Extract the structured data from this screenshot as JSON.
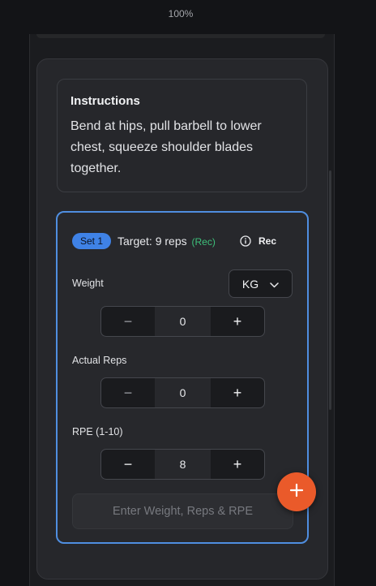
{
  "zoom": "100%",
  "instructions": {
    "title": "Instructions",
    "text": "Bend at hips, pull barbell to lower chest, squeeze shoulder blades together."
  },
  "set": {
    "badge": "Set 1",
    "target": "Target: 9 reps",
    "target_tag": "(Rec)",
    "rec_label": "Rec",
    "weight_label": "Weight",
    "unit": "KG",
    "weight_value": "0",
    "reps_label": "Actual Reps",
    "reps_value": "0",
    "rpe_label": "RPE (1-10)",
    "rpe_value": "8",
    "submit_label": "Enter Weight, Reps & RPE"
  },
  "colors": {
    "accent": "#3f82e6",
    "fab": "#ea5a2a",
    "rec": "#3dc07a"
  },
  "icons": {
    "info": "info-icon",
    "chevron": "chevron-down-icon",
    "minus": "minus-icon",
    "plus": "plus-icon"
  }
}
